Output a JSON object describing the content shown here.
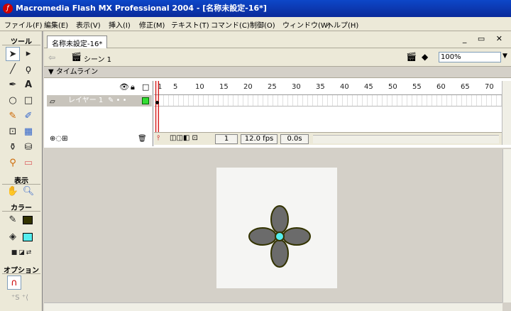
{
  "window": {
    "title": "Macromedia Flash MX Professional 2004 - [名称未設定-16*]"
  },
  "menu": [
    "ファイル(F)",
    "編集(E)",
    "表示(V)",
    "挿入(I)",
    "修正(M)",
    "テキスト(T)",
    "コマンド(C)",
    "制御(O)",
    "ウィンドウ(W)",
    "ヘルプ(H)"
  ],
  "toolbox": {
    "tools_header": "ツール",
    "view_header": "表示",
    "color_header": "カラー",
    "options_header": "オプション"
  },
  "document": {
    "tab": "名称未設定-16*",
    "scene": "シーン 1",
    "zoom": "100%"
  },
  "timeline": {
    "header": "タイムライン",
    "layer_name": "レイヤー 1",
    "frame_numbers": [
      "1",
      "5",
      "10",
      "15",
      "20",
      "25",
      "30",
      "35",
      "40",
      "45",
      "50",
      "55",
      "60",
      "65",
      "70"
    ],
    "current_frame": "1",
    "fps": "12.0 fps",
    "elapsed": "0.0s"
  },
  "colors": {
    "stroke": "#333300",
    "fill": "#55eeee",
    "petal": "#6b6b6b",
    "center": "#55eeee"
  }
}
